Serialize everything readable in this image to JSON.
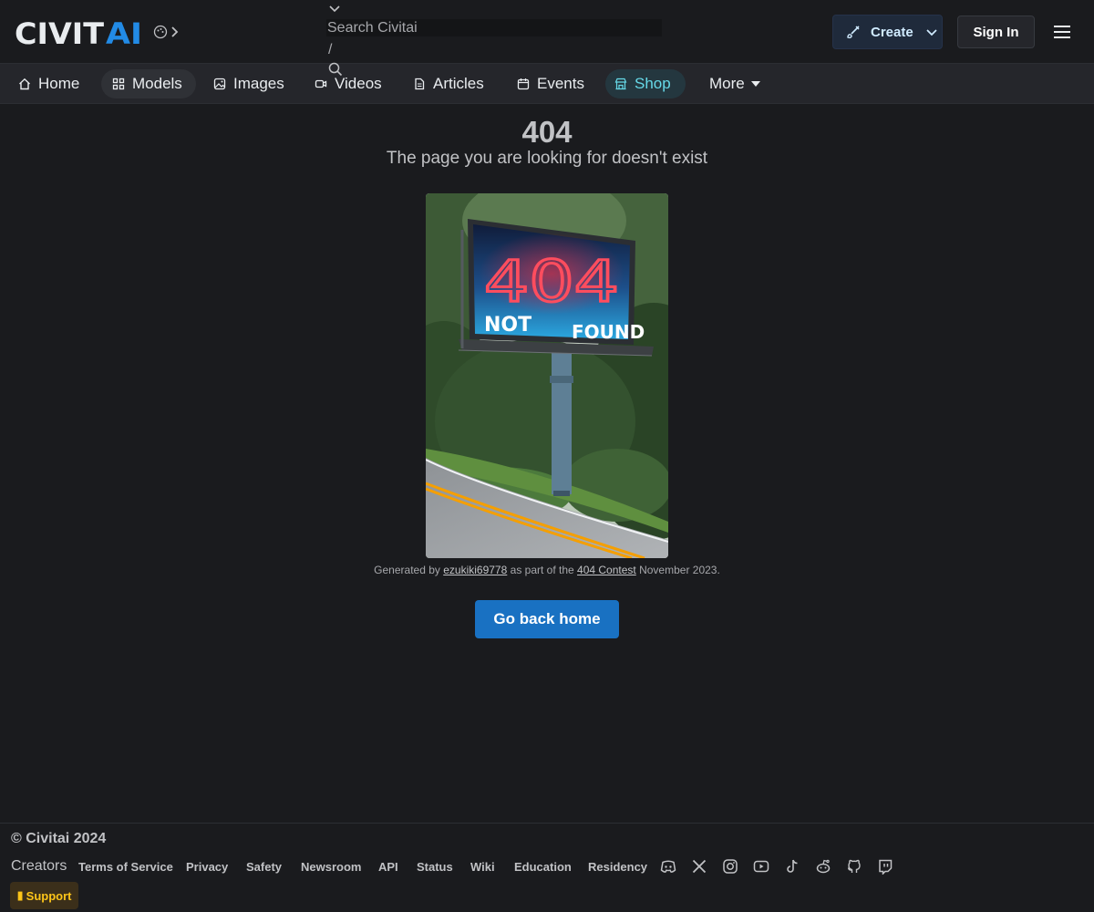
{
  "header": {
    "logo_text": "CIVITAI",
    "search": {
      "placeholder": "Search Civitai",
      "shortcut": "/"
    },
    "create_label": "Create",
    "signin_label": "Sign In"
  },
  "nav": {
    "items": [
      {
        "label": "Home",
        "icon": "home-icon"
      },
      {
        "label": "Models",
        "icon": "grid-icon",
        "active": true
      },
      {
        "label": "Images",
        "icon": "photo-icon"
      },
      {
        "label": "Videos",
        "icon": "video-icon"
      },
      {
        "label": "Articles",
        "icon": "article-icon"
      },
      {
        "label": "Events",
        "icon": "calendar-icon"
      },
      {
        "label": "Shop",
        "icon": "building-store-icon"
      },
      {
        "label": "More",
        "icon": "caret-down-icon"
      }
    ]
  },
  "main": {
    "code": "404",
    "message": "The page you are looking for doesn't exist",
    "image_sign": {
      "line1": "404",
      "line2_left": "NOT",
      "line2_right": "FOUND"
    },
    "caption": {
      "prefix": "Generated by",
      "user": "ezukiki69778",
      "middle": "as part of the",
      "contest": "404 Contest",
      "suffix": "November 2023."
    },
    "home_button": "Go back home"
  },
  "footer": {
    "copyright": "© Civitai 2024",
    "creators": "Creators",
    "links": [
      "Terms of Service",
      "Privacy",
      "Safety",
      "Newsroom",
      "API",
      "Status",
      "Wiki",
      "Education",
      "Residency"
    ],
    "social_icons": [
      "discord-icon",
      "x-icon",
      "instagram-icon",
      "youtube-icon",
      "tiktok-icon",
      "reddit-icon",
      "github-icon",
      "twitch-icon"
    ],
    "support_label": "Support"
  },
  "colors": {
    "background": "#1a1b1e",
    "nav_background": "#25262b",
    "accent_blue": "#1971c2",
    "shop_cyan": "#66d9e8",
    "support_yellow": "#fcc419"
  }
}
